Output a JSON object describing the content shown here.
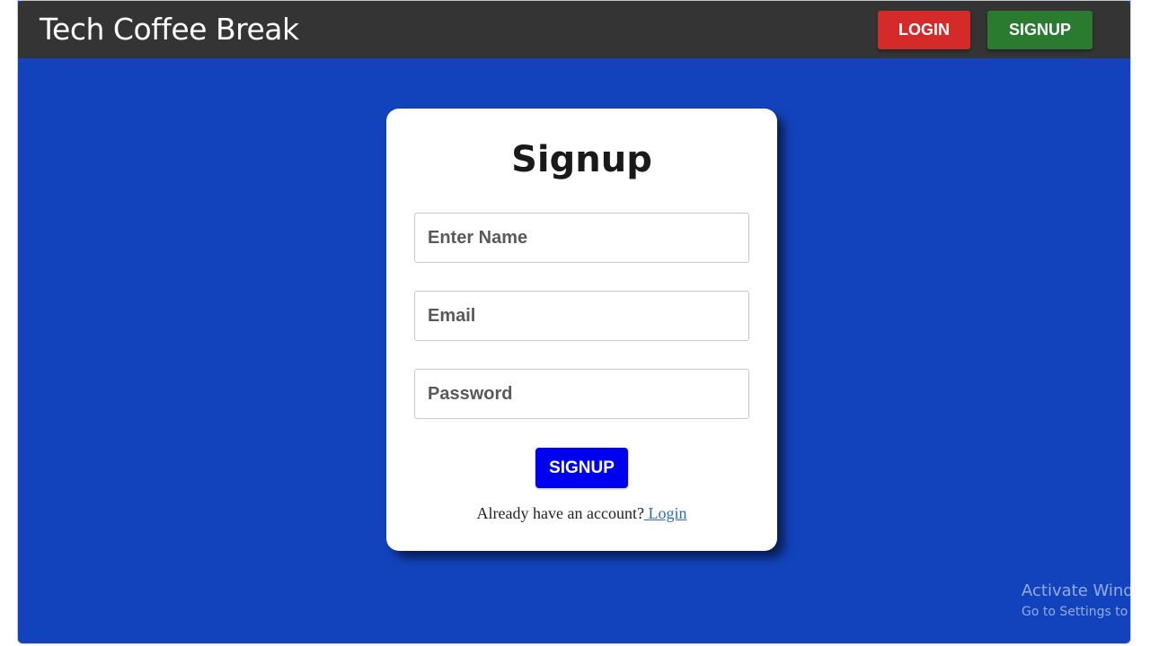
{
  "header": {
    "brand": "Tech Coffee Break",
    "login_label": "LOGIN",
    "signup_label": "SIGNUP"
  },
  "form": {
    "title": "Signup",
    "name_placeholder": "Enter Name",
    "email_placeholder": "Email",
    "password_placeholder": "Password",
    "submit_label": "SIGNUP",
    "prompt_text": "Already have an account?",
    "login_link": " Login"
  },
  "watermark": {
    "line1": "Activate Wind",
    "line2": "Go to Settings to a"
  },
  "colors": {
    "background": "#1243bd",
    "topbar": "#343434",
    "login_button": "#d42a2a",
    "signup_button": "#2a7a2f",
    "submit_button": "#0000f0"
  }
}
